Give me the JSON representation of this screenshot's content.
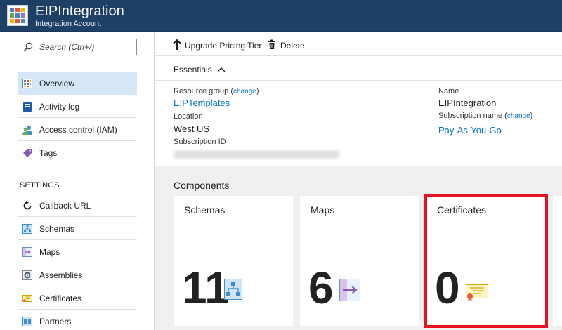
{
  "header": {
    "title": "EIPIntegration",
    "subtitle": "Integration Account"
  },
  "sidebar": {
    "search_placeholder": "Search (Ctrl+/)",
    "items": [
      {
        "label": "Overview",
        "icon": "overview-icon",
        "active": true
      },
      {
        "label": "Activity log",
        "icon": "activity-log-icon"
      },
      {
        "label": "Access control (IAM)",
        "icon": "access-control-icon"
      },
      {
        "label": "Tags",
        "icon": "tag-icon"
      }
    ],
    "settings_label": "SETTINGS",
    "settings_items": [
      {
        "label": "Callback URL",
        "icon": "refresh-icon"
      },
      {
        "label": "Schemas",
        "icon": "schema-icon"
      },
      {
        "label": "Maps",
        "icon": "map-icon"
      },
      {
        "label": "Assemblies",
        "icon": "assembly-icon"
      },
      {
        "label": "Certificates",
        "icon": "certificate-icon"
      },
      {
        "label": "Partners",
        "icon": "partner-icon"
      }
    ]
  },
  "toolbar": {
    "upgrade_label": "Upgrade Pricing Tier",
    "delete_label": "Delete"
  },
  "essentials": {
    "toggle_label": "Essentials",
    "change_label": "change",
    "resource_group_label": "Resource group",
    "resource_group_value": "EIPTemplates",
    "location_label": "Location",
    "location_value": "West US",
    "subscription_id_label": "Subscription ID",
    "name_label": "Name",
    "name_value": "EIPIntegration",
    "subscription_name_label": "Subscription name",
    "subscription_name_value": "Pay-As-You-Go"
  },
  "components": {
    "title": "Components",
    "tiles": [
      {
        "title": "Schemas",
        "count": "11",
        "icon": "schema-icon"
      },
      {
        "title": "Maps",
        "count": "6",
        "icon": "map-icon"
      },
      {
        "title": "Certificates",
        "count": "0",
        "icon": "certificate-icon",
        "highlighted": true
      }
    ]
  },
  "colors": {
    "header_bg": "#1e3f66",
    "active_nav_bg": "#d5e6f7",
    "link": "#0072c6",
    "highlight": "#e81123",
    "components_bg": "#f0f0f0"
  }
}
